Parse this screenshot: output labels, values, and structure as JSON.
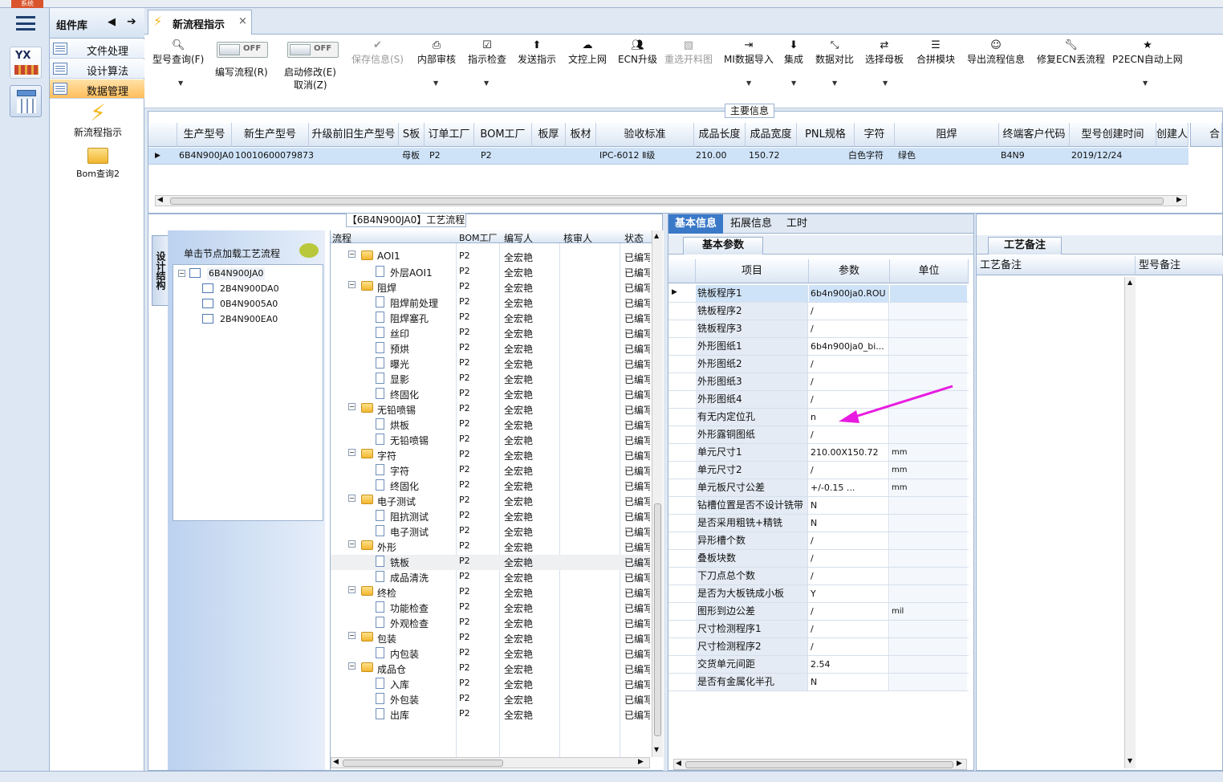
{
  "system_button": "系统",
  "component_library": {
    "title": "组件库",
    "items": [
      {
        "label": "文件处理"
      },
      {
        "label": "设计算法"
      },
      {
        "label": "数据管理",
        "selected": true
      }
    ],
    "shortcuts": [
      {
        "label": "新流程指示",
        "icon": "lightning-icon"
      },
      {
        "label": "Bom查询2",
        "icon": "folder-icon"
      }
    ]
  },
  "rail": {
    "logo_text": "YX"
  },
  "tab": {
    "title": "新流程指示",
    "close": "×"
  },
  "toolbar": {
    "query": "型号查询(F)",
    "edit_flow": "编写流程(R)",
    "edit_flow_toggle": "OFF",
    "start_modify": "启动修改(E)",
    "start_modify_toggle": "OFF",
    "cancel": "取消(Z)",
    "save": "保存信息(S)",
    "audit": "内部审核",
    "check": "指示检查",
    "send": "发送指示",
    "upload": "文控上网",
    "ecn": "ECN升级",
    "pick_drawing": "重选开料图",
    "mi_import": "MI数据导入",
    "integrate": "集成",
    "compare": "数据对比",
    "select_mother": "选择母板",
    "merge": "合拼模块",
    "export_flow": "导出流程信息",
    "fix_ecn": "修复ECN丢流程",
    "p2ecn": "P2ECN自动上网"
  },
  "main_info": {
    "title": "主要信息",
    "columns": [
      "生产型号",
      "新生产型号",
      "升级前旧生产型号",
      "S板",
      "订单工厂",
      "BOM工厂",
      "板厚",
      "板材",
      "验收标准",
      "成品长度",
      "成品宽度",
      "PNL规格",
      "字符",
      "阻焊",
      "终端客户代码",
      "型号创建时间",
      "创建人"
    ],
    "row": [
      "6B4N900JA0",
      "10010600079873",
      "",
      "母板",
      "P2",
      "P2",
      "",
      "",
      "IPC-6012 Ⅱ级",
      "210.00",
      "150.72",
      "",
      "白色字符",
      "绿色",
      "B4N9",
      "2019/12/24",
      ""
    ],
    "side_header": "合"
  },
  "process": {
    "title": "【6B4N900JA0】工艺流程",
    "vertical_tab": "设计结构",
    "tree_header": "单击节点加载工艺流程",
    "tree": {
      "root": "6B4N900JA0",
      "children": [
        "2B4N900DA0",
        "0B4N9005A0",
        "2B4N900EA0"
      ]
    },
    "columns": [
      "流程",
      "BOM工厂",
      "编写人",
      "核审人",
      "状态"
    ],
    "rows": [
      {
        "name": "AOI1",
        "level": 1,
        "factory": "P2",
        "author": "全宏艳",
        "reviewer": "",
        "status": "已编写"
      },
      {
        "name": "外层AOI1",
        "level": 2,
        "factory": "P2",
        "author": "全宏艳",
        "reviewer": "",
        "status": "已编写"
      },
      {
        "name": "阻焊",
        "level": 1,
        "factory": "P2",
        "author": "全宏艳",
        "reviewer": "",
        "status": "已编写"
      },
      {
        "name": "阻焊前处理",
        "level": 2,
        "factory": "P2",
        "author": "全宏艳",
        "reviewer": "",
        "status": "已编写"
      },
      {
        "name": "阻焊塞孔",
        "level": 2,
        "factory": "P2",
        "author": "全宏艳",
        "reviewer": "",
        "status": "已编写"
      },
      {
        "name": "丝印",
        "level": 2,
        "factory": "P2",
        "author": "全宏艳",
        "reviewer": "",
        "status": "已编写"
      },
      {
        "name": "预烘",
        "level": 2,
        "factory": "P2",
        "author": "全宏艳",
        "reviewer": "",
        "status": "已编写"
      },
      {
        "name": "曝光",
        "level": 2,
        "factory": "P2",
        "author": "全宏艳",
        "reviewer": "",
        "status": "已编写"
      },
      {
        "name": "显影",
        "level": 2,
        "factory": "P2",
        "author": "全宏艳",
        "reviewer": "",
        "status": "已编写"
      },
      {
        "name": "终固化",
        "level": 2,
        "factory": "P2",
        "author": "全宏艳",
        "reviewer": "",
        "status": "已编写"
      },
      {
        "name": "无铅喷锡",
        "level": 1,
        "factory": "P2",
        "author": "全宏艳",
        "reviewer": "",
        "status": "已编写"
      },
      {
        "name": "烘板",
        "level": 2,
        "factory": "P2",
        "author": "全宏艳",
        "reviewer": "",
        "status": "已编写"
      },
      {
        "name": "无铅喷锡",
        "level": 2,
        "factory": "P2",
        "author": "全宏艳",
        "reviewer": "",
        "status": "已编写"
      },
      {
        "name": "字符",
        "level": 1,
        "factory": "P2",
        "author": "全宏艳",
        "reviewer": "",
        "status": "已编写"
      },
      {
        "name": "字符",
        "level": 2,
        "factory": "P2",
        "author": "全宏艳",
        "reviewer": "",
        "status": "已编写"
      },
      {
        "name": "终固化",
        "level": 2,
        "factory": "P2",
        "author": "全宏艳",
        "reviewer": "",
        "status": "已编写"
      },
      {
        "name": "电子测试",
        "level": 1,
        "factory": "P2",
        "author": "全宏艳",
        "reviewer": "",
        "status": "已编写"
      },
      {
        "name": "阻抗测试",
        "level": 2,
        "factory": "P2",
        "author": "全宏艳",
        "reviewer": "",
        "status": "已编写"
      },
      {
        "name": "电子测试",
        "level": 2,
        "factory": "P2",
        "author": "全宏艳",
        "reviewer": "",
        "status": "已编写"
      },
      {
        "name": "外形",
        "level": 1,
        "factory": "P2",
        "author": "全宏艳",
        "reviewer": "",
        "status": "已编写"
      },
      {
        "name": "铣板",
        "level": 2,
        "factory": "P2",
        "author": "全宏艳",
        "reviewer": "",
        "status": "已编写",
        "selected": true
      },
      {
        "name": "成品清洗",
        "level": 2,
        "factory": "P2",
        "author": "全宏艳",
        "reviewer": "",
        "status": "已编写"
      },
      {
        "name": "终检",
        "level": 1,
        "factory": "P2",
        "author": "全宏艳",
        "reviewer": "",
        "status": "已编写"
      },
      {
        "name": "功能检查",
        "level": 2,
        "factory": "P2",
        "author": "全宏艳",
        "reviewer": "",
        "status": "已编写"
      },
      {
        "name": "外观检查",
        "level": 2,
        "factory": "P2",
        "author": "全宏艳",
        "reviewer": "",
        "status": "已编写"
      },
      {
        "name": "包装",
        "level": 1,
        "factory": "P2",
        "author": "全宏艳",
        "reviewer": "",
        "status": "已编写"
      },
      {
        "name": "内包装",
        "level": 2,
        "factory": "P2",
        "author": "全宏艳",
        "reviewer": "",
        "status": "已编写"
      },
      {
        "name": "成品仓",
        "level": 1,
        "factory": "P2",
        "author": "全宏艳",
        "reviewer": "",
        "status": "已编写"
      },
      {
        "name": "入库",
        "level": 2,
        "factory": "P2",
        "author": "全宏艳",
        "reviewer": "",
        "status": "已编写"
      },
      {
        "name": "外包装",
        "level": 2,
        "factory": "P2",
        "author": "全宏艳",
        "reviewer": "",
        "status": "已编写"
      },
      {
        "name": "出库",
        "level": 2,
        "factory": "P2",
        "author": "全宏艳",
        "reviewer": "",
        "status": "已编写"
      }
    ]
  },
  "detail": {
    "tabs": [
      "基本信息",
      "拓展信息",
      "工时"
    ],
    "subtab": "基本参数",
    "columns": [
      "项目",
      "参数",
      "单位"
    ],
    "rows": [
      {
        "item": "铣板程序1",
        "param": "6b4n900ja0.ROU",
        "unit": ""
      },
      {
        "item": "铣板程序2",
        "param": "/",
        "unit": ""
      },
      {
        "item": "铣板程序3",
        "param": "/",
        "unit": ""
      },
      {
        "item": "外形图纸1",
        "param": "6b4n900ja0_bi...",
        "unit": ""
      },
      {
        "item": "外形图纸2",
        "param": "/",
        "unit": ""
      },
      {
        "item": "外形图纸3",
        "param": "/",
        "unit": ""
      },
      {
        "item": "外形图纸4",
        "param": "/",
        "unit": ""
      },
      {
        "item": "有无内定位孔",
        "param": "n",
        "unit": ""
      },
      {
        "item": "外形露铜图纸",
        "param": "/",
        "unit": ""
      },
      {
        "item": "单元尺寸1",
        "param": "210.00X150.72",
        "unit": "mm"
      },
      {
        "item": "单元尺寸2",
        "param": "/",
        "unit": "mm"
      },
      {
        "item": "单元板尺寸公差",
        "param": "+/-0.15      ...",
        "unit": "mm"
      },
      {
        "item": "钻槽位置是否不设计铣带",
        "param": "N",
        "unit": ""
      },
      {
        "item": "是否采用粗铣+精铣",
        "param": "N",
        "unit": ""
      },
      {
        "item": "异形槽个数",
        "param": "/",
        "unit": ""
      },
      {
        "item": "叠板块数",
        "param": "/",
        "unit": ""
      },
      {
        "item": "下刀点总个数",
        "param": "/",
        "unit": ""
      },
      {
        "item": "是否为大板铣成小板",
        "param": "Y",
        "unit": ""
      },
      {
        "item": "图形到边公差",
        "param": "/",
        "unit": "mil"
      },
      {
        "item": "尺寸检测程序1",
        "param": "/",
        "unit": ""
      },
      {
        "item": "尺寸检测程序2",
        "param": "/",
        "unit": ""
      },
      {
        "item": "交货单元间距",
        "param": "2.54",
        "unit": ""
      },
      {
        "item": "是否有金属化半孔",
        "param": "N",
        "unit": ""
      }
    ]
  },
  "remark": {
    "tab": "工艺备注",
    "col1": "工艺备注",
    "col2": "型号备注"
  },
  "colors": {
    "accent": "#3a78c8",
    "selected_row": "#cfe3f8",
    "arrow": "#e81ce0"
  }
}
